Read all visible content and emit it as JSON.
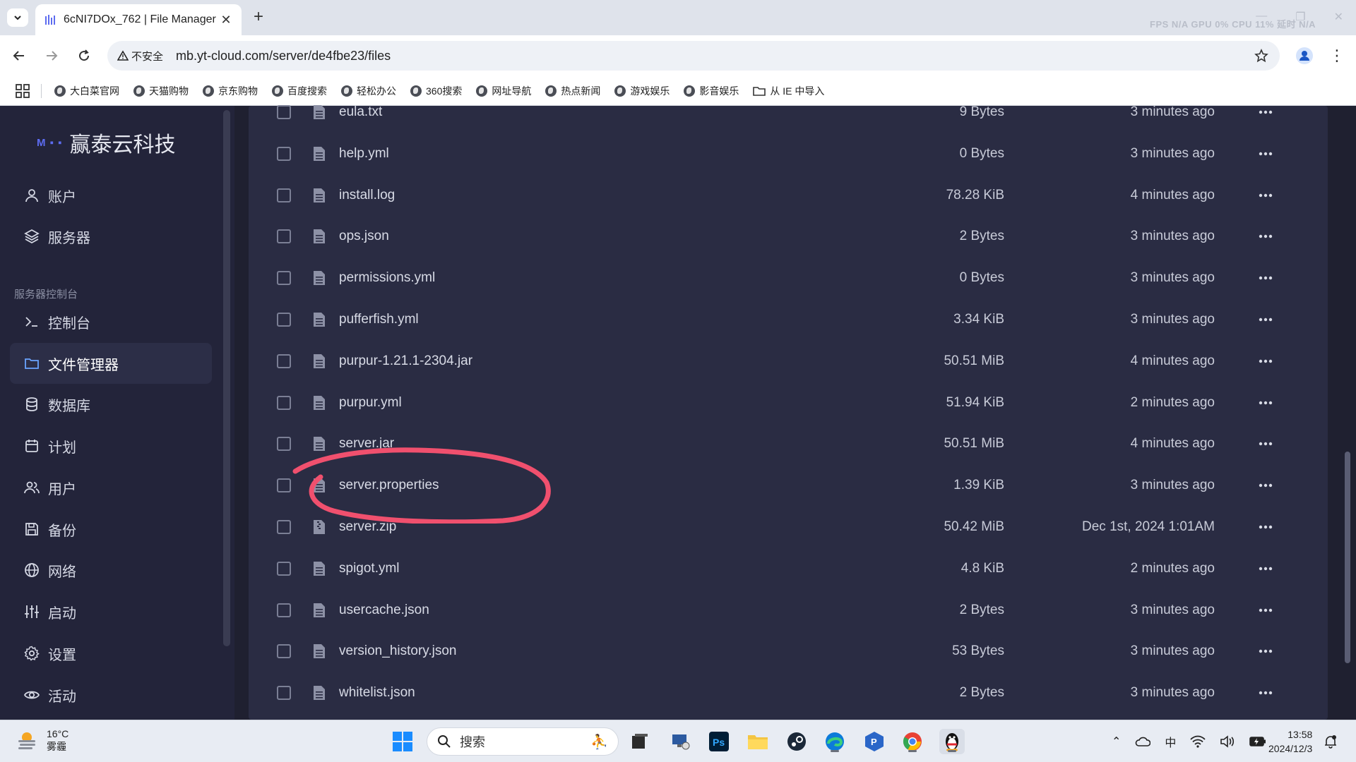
{
  "browser": {
    "tab_title": "6cNI7DOx_762 | File Manager",
    "security_label": "不安全",
    "url": "mb.yt-cloud.com/server/de4fbe23/files",
    "perf_overlay": "FPS N/A GPU 0% CPU 11% 延时 N/A",
    "bookmarks": [
      "大白菜官网",
      "天猫购物",
      "京东购物",
      "百度搜索",
      "轻松办公",
      "360搜索",
      "网址导航",
      "热点新闻",
      "游戏娱乐",
      "影音娱乐",
      "从 IE 中导入"
    ]
  },
  "sidebar": {
    "brand": "赢泰云科技",
    "brand_logo": "M ▪ ▪",
    "items": [
      {
        "label": "账户",
        "icon": "user-icon"
      },
      {
        "label": "服务器",
        "icon": "layers-icon"
      }
    ],
    "section_title": "服务器控制台",
    "console_items": [
      {
        "label": "控制台",
        "icon": "terminal-icon"
      },
      {
        "label": "文件管理器",
        "icon": "folder-icon",
        "active": true
      },
      {
        "label": "数据库",
        "icon": "database-icon"
      },
      {
        "label": "计划",
        "icon": "calendar-icon"
      },
      {
        "label": "用户",
        "icon": "users-icon"
      },
      {
        "label": "备份",
        "icon": "save-icon"
      },
      {
        "label": "网络",
        "icon": "globe-icon"
      },
      {
        "label": "启动",
        "icon": "sliders-icon"
      },
      {
        "label": "设置",
        "icon": "gear-icon"
      },
      {
        "label": "活动",
        "icon": "eye-icon"
      }
    ]
  },
  "files": [
    {
      "name": "eula.txt",
      "size": "9 Bytes",
      "modified": "3 minutes ago",
      "icon": "file-icon"
    },
    {
      "name": "help.yml",
      "size": "0 Bytes",
      "modified": "3 minutes ago",
      "icon": "file-icon"
    },
    {
      "name": "install.log",
      "size": "78.28 KiB",
      "modified": "4 minutes ago",
      "icon": "file-icon"
    },
    {
      "name": "ops.json",
      "size": "2 Bytes",
      "modified": "3 minutes ago",
      "icon": "file-icon"
    },
    {
      "name": "permissions.yml",
      "size": "0 Bytes",
      "modified": "3 minutes ago",
      "icon": "file-icon"
    },
    {
      "name": "pufferfish.yml",
      "size": "3.34 KiB",
      "modified": "3 minutes ago",
      "icon": "file-icon"
    },
    {
      "name": "purpur-1.21.1-2304.jar",
      "size": "50.51 MiB",
      "modified": "4 minutes ago",
      "icon": "file-icon"
    },
    {
      "name": "purpur.yml",
      "size": "51.94 KiB",
      "modified": "2 minutes ago",
      "icon": "file-icon"
    },
    {
      "name": "server.jar",
      "size": "50.51 MiB",
      "modified": "4 minutes ago",
      "icon": "file-icon"
    },
    {
      "name": "server.properties",
      "size": "1.39 KiB",
      "modified": "3 minutes ago",
      "icon": "file-icon"
    },
    {
      "name": "server.zip",
      "size": "50.42 MiB",
      "modified": "Dec 1st, 2024 1:01AM",
      "icon": "archive-icon"
    },
    {
      "name": "spigot.yml",
      "size": "4.8 KiB",
      "modified": "2 minutes ago",
      "icon": "file-icon"
    },
    {
      "name": "usercache.json",
      "size": "2 Bytes",
      "modified": "3 minutes ago",
      "icon": "file-icon"
    },
    {
      "name": "version_history.json",
      "size": "53 Bytes",
      "modified": "3 minutes ago",
      "icon": "file-icon"
    },
    {
      "name": "whitelist.json",
      "size": "2 Bytes",
      "modified": "3 minutes ago",
      "icon": "file-icon"
    }
  ],
  "annotation": {
    "target": "server.properties",
    "color": "#f0506e"
  },
  "taskbar": {
    "weather_temp": "16°C",
    "weather_desc": "雾霾",
    "search_placeholder": "搜索",
    "ime": "中",
    "time": "13:58",
    "date": "2024/12/3"
  },
  "colors": {
    "page_bg": "#1f2030",
    "sidebar_bg": "#23243a",
    "content_bg": "#2a2c43",
    "accent": "#5d6cf0"
  }
}
